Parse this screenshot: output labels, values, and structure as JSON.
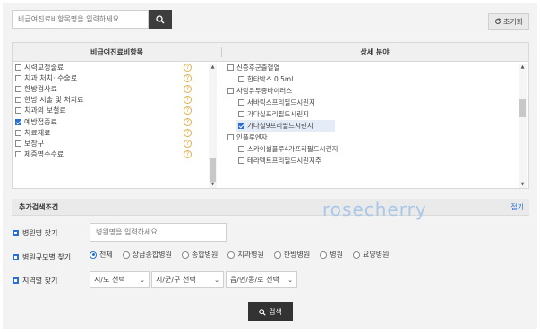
{
  "search": {
    "placeholder": "비급여진료비항목명을 입력하세요"
  },
  "reset": {
    "label": "초기화"
  },
  "categories": {
    "left_header": "비급여진료비항목",
    "right_header": "상세 분야",
    "left_items": [
      {
        "label": "시력교정술료",
        "checked": false
      },
      {
        "label": "치과 처치· 수술료",
        "checked": false
      },
      {
        "label": "한방검사료",
        "checked": false
      },
      {
        "label": "한방 시술 및 처치료",
        "checked": false
      },
      {
        "label": "치과의 보철료",
        "checked": false
      },
      {
        "label": "예방접종료",
        "checked": true
      },
      {
        "label": "치료재료",
        "checked": false
      },
      {
        "label": "보장구",
        "checked": false
      },
      {
        "label": "제증명수수료",
        "checked": false
      }
    ],
    "right_items": [
      {
        "label": "신증후군출혈열",
        "indent": false,
        "checked": false,
        "selected": false
      },
      {
        "label": "한타박스 0.5ml",
        "indent": true,
        "checked": false,
        "selected": false
      },
      {
        "label": "사람유두종바이러스",
        "indent": false,
        "checked": false,
        "selected": false
      },
      {
        "label": "서바릭스프리필드시린지",
        "indent": true,
        "checked": false,
        "selected": false
      },
      {
        "label": "가다실프리필드시린지",
        "indent": true,
        "checked": false,
        "selected": false
      },
      {
        "label": "가다실9프리필드시린지",
        "indent": true,
        "checked": true,
        "selected": true
      },
      {
        "label": "인플루엔자",
        "indent": false,
        "checked": false,
        "selected": false
      },
      {
        "label": "스카이셀플루4가프리필드시린지",
        "indent": true,
        "checked": false,
        "selected": false
      },
      {
        "label": "테라텍트프리필드시린지주",
        "indent": true,
        "checked": false,
        "selected": false
      }
    ]
  },
  "extra": {
    "title": "추가검색조건",
    "fold_label": "접기",
    "watermark": "rosecherry"
  },
  "hospital_name": {
    "label": "병원명 찾기",
    "placeholder": "병원명을 입력하세요."
  },
  "hospital_type": {
    "label": "병원규모별 찾기",
    "options": [
      "전체",
      "상급종합병원",
      "종합병원",
      "치과병원",
      "한방병원",
      "병원",
      "요양병원"
    ],
    "selected": "전체"
  },
  "region": {
    "label": "지역별 찾기",
    "sido": "시/도 선택",
    "sigungu": "시/군/구 선택",
    "emd": "읍/면/동/로 선택"
  },
  "submit": {
    "label": "검색"
  }
}
